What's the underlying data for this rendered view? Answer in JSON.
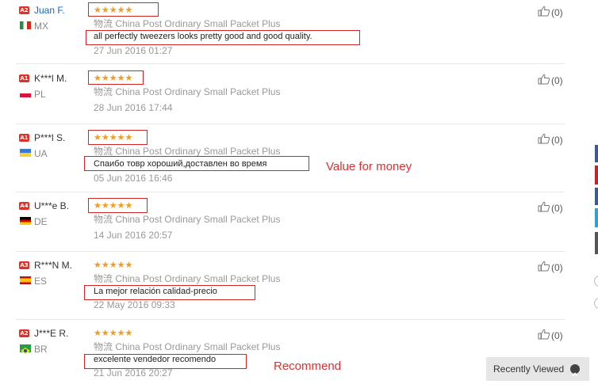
{
  "reviews": [
    {
      "level": "A2",
      "name": "Juan F.",
      "name_is_link": true,
      "country": "MX",
      "flag": [
        "#2e8b3d",
        "#ffffff",
        "#d52b1e"
      ],
      "flag_dir": "vertical",
      "stars": "★★★★★",
      "rating": 5,
      "shipping_zh": "物流",
      "shipping": "China Post Ordinary Small Packet Plus",
      "feedback": "all perfectly tweezers looks pretty good and good quality.",
      "date": "27 Jun 2016 01:27",
      "likes": "(0)"
    },
    {
      "level": "A1",
      "name": "K***l M.",
      "name_is_link": false,
      "country": "PL",
      "flag": [
        "#ffffff",
        "#dc143c"
      ],
      "flag_dir": "horizontal",
      "stars": "★★★★★",
      "rating": 5,
      "shipping_zh": "物流",
      "shipping": "China Post Ordinary Small Packet Plus",
      "feedback": "",
      "date": "28 Jun 2016 17:44",
      "likes": "(0)"
    },
    {
      "level": "A1",
      "name": "P***l S.",
      "name_is_link": false,
      "country": "UA",
      "flag": [
        "#3a7ad6",
        "#f7d13b"
      ],
      "flag_dir": "horizontal",
      "stars": "★★★★★",
      "rating": 5,
      "shipping_zh": "物流",
      "shipping": "China Post Ordinary Small Packet Plus",
      "feedback": "Спаибо товр хороший,доставлен во время",
      "date": "05 Jun 2016 16:46",
      "likes": "(0)"
    },
    {
      "level": "A4",
      "name": "U***e B.",
      "name_is_link": false,
      "country": "DE",
      "flag": [
        "#000000",
        "#dd0000",
        "#ffce00"
      ],
      "flag_dir": "horizontal",
      "stars": "★★★★★",
      "rating": 5,
      "shipping_zh": "物流",
      "shipping": "China Post Ordinary Small Packet Plus",
      "feedback": "",
      "date": "14 Jun 2016 20:57",
      "likes": "(0)"
    },
    {
      "level": "A3",
      "name": "R***N M.",
      "name_is_link": false,
      "country": "ES",
      "flag": [
        "#c60b1e",
        "#ffc400",
        "#c60b1e"
      ],
      "flag_dir": "horizontal",
      "stars": "★★★★★",
      "rating": 5,
      "shipping_zh": "物流",
      "shipping": "China Post Ordinary Small Packet Plus",
      "feedback": "La mejor relación calidad-precio",
      "date": "22 May 2016 09:33",
      "likes": "(0)"
    },
    {
      "level": "A2",
      "name": "J***E R.",
      "name_is_link": false,
      "country": "BR",
      "flag": [
        "#229e45",
        "#f8e509",
        "#2b49a3"
      ],
      "flag_dir": "diamond",
      "stars": "★★★★★",
      "rating": 5,
      "shipping_zh": "物流",
      "shipping": "China Post Ordinary Small Packet Plus",
      "feedback": "excelente vendedor recomendo",
      "date": "21 Jun 2016 20:27",
      "likes": "(0)"
    }
  ],
  "annotations": {
    "note_ua": "Value for money",
    "note_br": "Recommend"
  },
  "recently_viewed": {
    "label": "Recently Viewed",
    "icon": "chevron-up-icon"
  },
  "colors": {
    "highlight": "#d32525",
    "star": "#f59a1d",
    "link": "#1a66c2",
    "level_badge": "#d9342b"
  },
  "side_share_colors": [
    "#3b5998",
    "#cb2027",
    "#3b5998",
    "#2aa4d8",
    "#555555"
  ]
}
